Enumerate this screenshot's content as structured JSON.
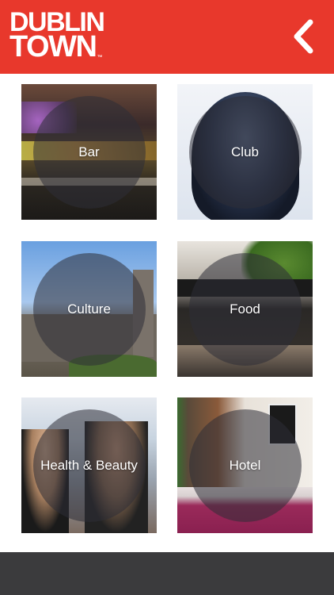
{
  "header": {
    "logo_line1": "DUBLIN",
    "logo_line2": "TOWN",
    "logo_tm": "™",
    "accent_color": "#e8382c",
    "back_icon": "chevron-left-icon"
  },
  "categories": [
    {
      "label": "Bar"
    },
    {
      "label": "Club"
    },
    {
      "label": "Culture"
    },
    {
      "label": "Food"
    },
    {
      "label": "Health & Beauty"
    },
    {
      "label": "Hotel"
    }
  ],
  "footer": {
    "color": "#3b3b3d"
  }
}
